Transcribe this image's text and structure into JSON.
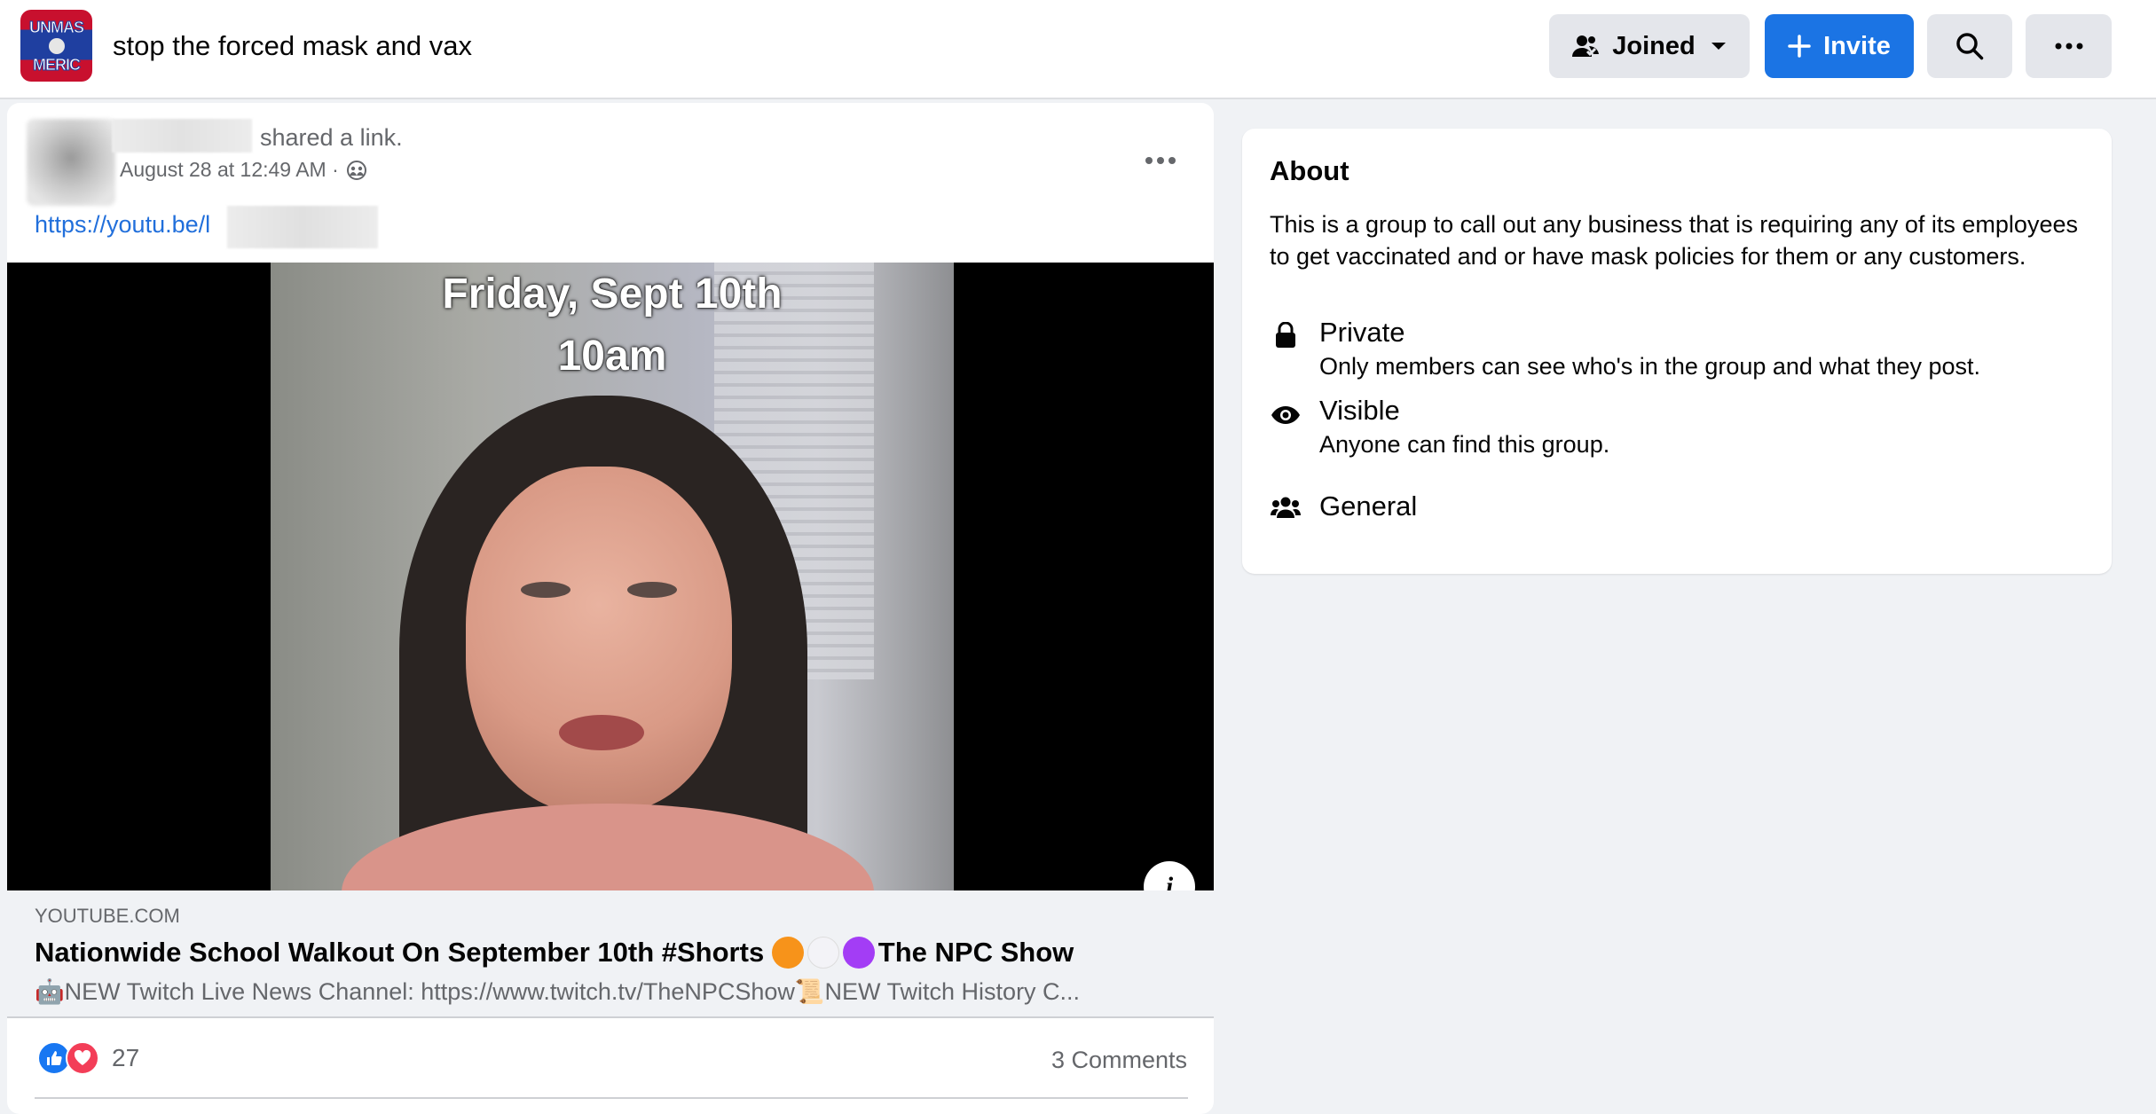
{
  "header": {
    "group_logo_text": "UNMASK AMERICA",
    "group_name": "stop the forced mask and vax",
    "joined_label": "Joined",
    "invite_label": "Invite",
    "search_icon": "search-icon",
    "more_icon": "more-horizontal-icon"
  },
  "post": {
    "shared_text": "shared a link.",
    "timestamp": "August 28 at 12:49 AM ·",
    "audience_icon": "group-audience-icon",
    "link_text": "https://youtu.be/l",
    "video_overlay_line1": "Friday, Sept 10th",
    "video_overlay_line2": "10am",
    "info_label": "i",
    "link_preview": {
      "domain": "YOUTUBE.COM",
      "title_prefix": "Nationwide School Walkout On September 10th #Shorts ",
      "title_suffix": "The NPC Show",
      "dot_colors": [
        "#f7931a",
        "#f3f3f7",
        "#a33df5"
      ],
      "description": "🤖NEW Twitch Live News Channel: https://www.twitch.tv/TheNPCShow📜NEW Twitch History C..."
    },
    "reaction_count": "27",
    "comments_count": "3 Comments"
  },
  "about": {
    "title": "About",
    "description": "This is a group to call out any business that is requiring any of its employees to get vaccinated and or have mask policies for them or any customers.",
    "items": [
      {
        "icon": "lock-icon",
        "heading": "Private",
        "subtext": "Only members can see who's in the group and what they post."
      },
      {
        "icon": "eye-icon",
        "heading": "Visible",
        "subtext": "Anyone can find this group."
      },
      {
        "icon": "people-icon",
        "heading": "General",
        "subtext": ""
      }
    ]
  },
  "colors": {
    "accent": "#1b74e4",
    "link": "#216fdb",
    "background": "#f0f2f5",
    "secondary_text": "#65676b"
  }
}
